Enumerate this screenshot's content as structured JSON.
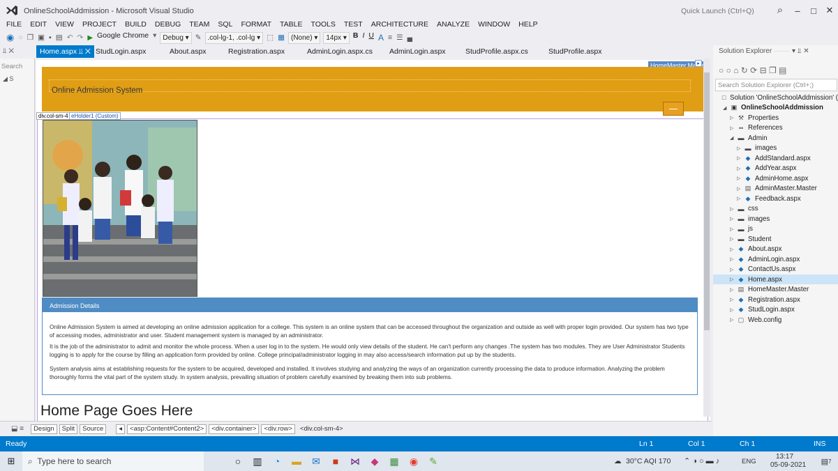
{
  "window": {
    "title": "OnlineSchoolAddmission - Microsoft Visual Studio",
    "quick_launch_placeholder": "Quick Launch (Ctrl+Q)"
  },
  "menu": [
    "FILE",
    "EDIT",
    "VIEW",
    "PROJECT",
    "BUILD",
    "DEBUG",
    "TEAM",
    "SQL",
    "FORMAT",
    "TABLE",
    "TOOLS",
    "TEST",
    "ARCHITECTURE",
    "ANALYZE",
    "WINDOW",
    "HELP"
  ],
  "toolbar": {
    "run_target": "Google Chrome",
    "config": "Debug",
    "css_class": ".col-lg-1, .col-lg",
    "style_none": "(None)",
    "font_size": "14px",
    "bold": "B",
    "italic": "I",
    "underline": "U"
  },
  "tabs": [
    "Home.aspx",
    "StudLogin.aspx",
    "About.aspx",
    "Registration.aspx",
    "AdminLogin.aspx.cs",
    "AdminLogin.aspx",
    "StudProfile.aspx.cs",
    "StudProfile.aspx"
  ],
  "toolbox": {
    "search": "Search"
  },
  "designer": {
    "master_label": "HomeMaster.Master",
    "site_title": "Online Admission System",
    "tag_div": "div.col-sm-4",
    "tag_holder": "eHolder1 (Custom)",
    "panel_heading": "Admission Details",
    "paragraphs": [
      "Online Admission System is aimed at developing an online admission application for a college. This system is an online system that can be accessed throughout the organization and outside as well with proper login provided. Our system has two type of accessing modes, administrator and user. Student management system is managed by an administrator.",
      "It is the job of the administrator to admit and monitor the whole process. When a user log in to the system. He would only view details of the student. He can't perform any changes .The system has two modules. They are User Administrator Students logging is to apply for the course by filling an application form provided by online. College principal/administrator logging in may also access/search information put up by the students.",
      "System analysis aims at establishing requests for the system to be acquired, developed and installed. It involves studying and analyzing the ways of an organization currently processing the data to produce information. Analyzing the problem thoroughly forms the vital part of the system study. In system analysis, prevailing situation of problem carefully examined by breaking them into sub problems."
    ],
    "home_heading": "Home Page Goes Here"
  },
  "view_bar": {
    "design": "Design",
    "split": "Split",
    "source": "Source",
    "crumbs": [
      "<asp:Content#Content2>",
      "<div.container>",
      "<div.row>",
      "<div.col-sm-4>"
    ]
  },
  "solution_explorer": {
    "title": "Solution Explorer",
    "search_placeholder": "Search Solution Explorer (Ctrl+;)",
    "nodes": [
      {
        "label": "Solution 'OnlineSchoolAddmission' (",
        "depth": 0,
        "bold": false,
        "icon": "solution-icon"
      },
      {
        "label": "OnlineSchoolAddmission",
        "depth": 1,
        "bold": true,
        "icon": "project-icon"
      },
      {
        "label": "Properties",
        "depth": 2,
        "bold": false,
        "icon": "wrench-icon"
      },
      {
        "label": "References",
        "depth": 2,
        "bold": false,
        "icon": "references-icon"
      },
      {
        "label": "Admin",
        "depth": 2,
        "bold": false,
        "icon": "folder-icon"
      },
      {
        "label": "images",
        "depth": 3,
        "bold": false,
        "icon": "folder-icon"
      },
      {
        "label": "AddStandard.aspx",
        "depth": 3,
        "bold": false,
        "icon": "aspx-file-icon"
      },
      {
        "label": "AddYear.aspx",
        "depth": 3,
        "bold": false,
        "icon": "aspx-file-icon"
      },
      {
        "label": "AdminHome.aspx",
        "depth": 3,
        "bold": false,
        "icon": "aspx-file-icon"
      },
      {
        "label": "AdminMaster.Master",
        "depth": 3,
        "bold": false,
        "icon": "master-file-icon"
      },
      {
        "label": "Feedback.aspx",
        "depth": 3,
        "bold": false,
        "icon": "aspx-file-icon"
      },
      {
        "label": "css",
        "depth": 2,
        "bold": false,
        "icon": "folder-icon"
      },
      {
        "label": "images",
        "depth": 2,
        "bold": false,
        "icon": "folder-icon"
      },
      {
        "label": "js",
        "depth": 2,
        "bold": false,
        "icon": "folder-icon"
      },
      {
        "label": "Student",
        "depth": 2,
        "bold": false,
        "icon": "folder-icon"
      },
      {
        "label": "About.aspx",
        "depth": 2,
        "bold": false,
        "icon": "aspx-file-icon"
      },
      {
        "label": "AdminLogin.aspx",
        "depth": 2,
        "bold": false,
        "icon": "aspx-file-icon"
      },
      {
        "label": "ContactUs.aspx",
        "depth": 2,
        "bold": false,
        "icon": "aspx-file-icon"
      },
      {
        "label": "Home.aspx",
        "depth": 2,
        "bold": false,
        "icon": "aspx-file-icon",
        "selected": true
      },
      {
        "label": "HomeMaster.Master",
        "depth": 2,
        "bold": false,
        "icon": "master-file-icon"
      },
      {
        "label": "Registration.aspx",
        "depth": 2,
        "bold": false,
        "icon": "aspx-file-icon"
      },
      {
        "label": "StudLogin.aspx",
        "depth": 2,
        "bold": false,
        "icon": "aspx-file-icon"
      },
      {
        "label": "Web.config",
        "depth": 2,
        "bold": false,
        "icon": "config-file-icon"
      }
    ]
  },
  "status": {
    "ready": "Ready",
    "ln": "Ln 1",
    "col": "Col 1",
    "ch": "Ch 1",
    "ins": "INS"
  },
  "taskbar": {
    "search_placeholder": "Type here to search",
    "weather": "30°C AQI 170",
    "lang": "ENG",
    "time": "13:17",
    "date": "05-09-2021",
    "notif_count": "7"
  },
  "colors": {
    "accent": "#007acc",
    "header_band": "#e09e14",
    "panel_blue": "#4f8cc4"
  }
}
